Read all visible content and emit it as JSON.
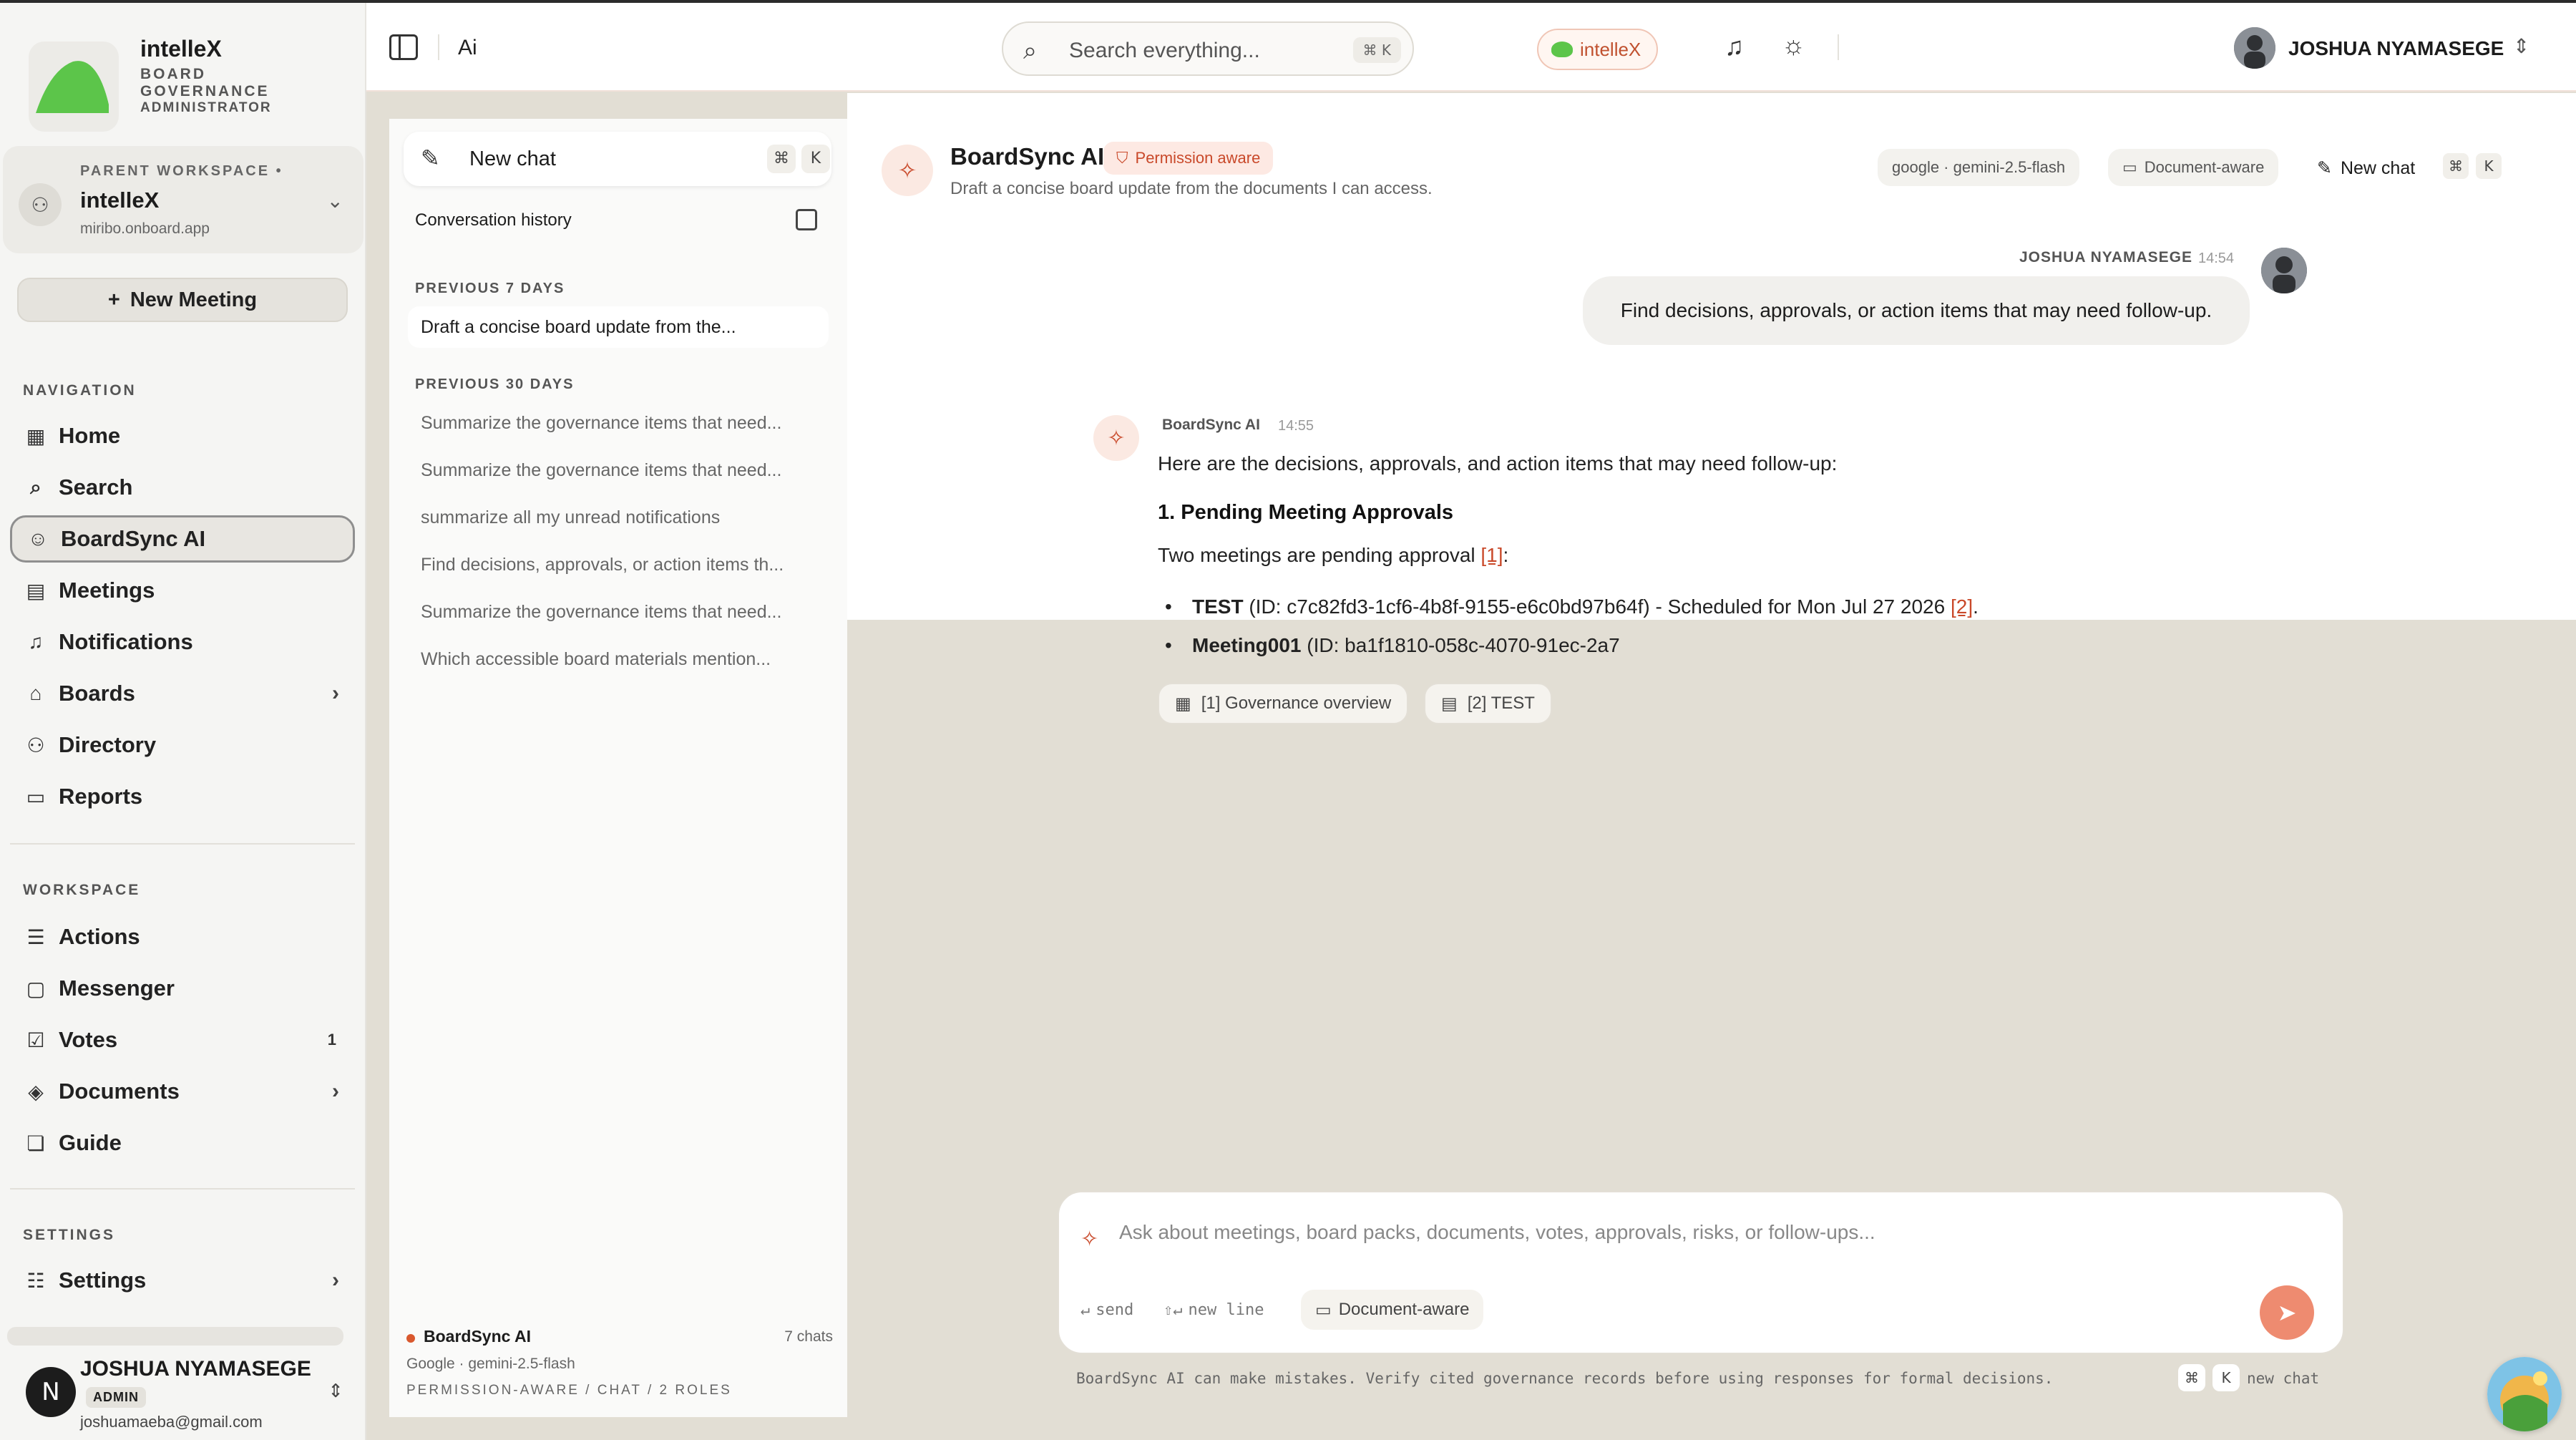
{
  "brand": {
    "name": "intelleX",
    "subtitle": "BOARD GOVERNANCE",
    "role": "ADMINISTRATOR"
  },
  "workspace": {
    "label": "PARENT WORKSPACE",
    "name": "intelleX",
    "url": "miribo.onboard.app"
  },
  "new_meeting_label": "New Meeting",
  "sidebar": {
    "navigation_label": "NAVIGATION",
    "navigation": [
      {
        "label": "Home",
        "icon": "grid-icon"
      },
      {
        "label": "Search",
        "icon": "telescope-icon"
      },
      {
        "label": "BoardSync AI",
        "icon": "bot-icon",
        "active": true
      },
      {
        "label": "Meetings",
        "icon": "calendar-icon"
      },
      {
        "label": "Notifications",
        "icon": "bell-icon"
      },
      {
        "label": "Boards",
        "icon": "building-icon",
        "chevron": true
      },
      {
        "label": "Directory",
        "icon": "users-icon"
      },
      {
        "label": "Reports",
        "icon": "file-icon"
      }
    ],
    "workspace_label": "WORKSPACE",
    "workspace": [
      {
        "label": "Actions",
        "icon": "list-check-icon"
      },
      {
        "label": "Messenger",
        "icon": "chat-icon"
      },
      {
        "label": "Votes",
        "icon": "vote-icon",
        "count": "1"
      },
      {
        "label": "Documents",
        "icon": "layers-icon",
        "chevron": true
      },
      {
        "label": "Guide",
        "icon": "book-icon"
      }
    ],
    "settings_label": "SETTINGS",
    "settings": [
      {
        "label": "Settings",
        "icon": "sliders-icon",
        "chevron": true
      }
    ]
  },
  "user_card": {
    "initial": "N",
    "name": "JOSHUA NYAMASEGE",
    "role": "ADMIN",
    "email": "joshuamaeba@gmail.com"
  },
  "topbar": {
    "breadcrumb": "Ai",
    "search_placeholder": "Search everything...",
    "search_shortcut": "⌘ K",
    "org_chip": "intelleX",
    "user_name": "JOSHUA NYAMASEGE"
  },
  "conversations": {
    "new_chat": "New chat",
    "kbd1": "⌘",
    "kbd2": "K",
    "history_label": "Conversation history",
    "sections": [
      {
        "label": "PREVIOUS 7 DAYS",
        "items": [
          "Draft a concise board update from the..."
        ]
      },
      {
        "label": "PREVIOUS 30 DAYS",
        "items": [
          "Summarize the governance items that need...",
          "Summarize the governance items that need...",
          "summarize all my unread notifications",
          "Find decisions, approvals, or action items th...",
          "Summarize the governance items that need...",
          "Which accessible board materials mention..."
        ]
      }
    ],
    "footer": {
      "name": "BoardSync AI",
      "count": "7 chats",
      "model": "Google · gemini-2.5-flash",
      "meta": "PERMISSION-AWARE / CHAT / 2 ROLES"
    }
  },
  "chat": {
    "title": "BoardSync AI",
    "badge": "Permission aware",
    "subtitle": "Draft a concise board update from the documents I can access.",
    "model_chip": "google · gemini-2.5-flash",
    "doc_chip": "Document-aware",
    "new_chat": "New chat",
    "kbd1": "⌘",
    "kbd2": "K",
    "user_message": {
      "author": "JOSHUA NYAMASEGE",
      "time": "14:54",
      "text": "Find decisions, approvals, or action items that may need follow-up."
    },
    "ai_message": {
      "author": "BoardSync AI",
      "time": "14:55",
      "intro": "Here are the decisions, approvals, and action items that may need follow-up:",
      "heading": "1. Pending Meeting Approvals",
      "para_prefix": "Two meetings are pending approval ",
      "para_cite": "[1]",
      "para_suffix": ":",
      "bullet1_bold": "TEST",
      "bullet1_text": " (ID: c7c82fd3-1cf6-4b8f-9155-e6c0bd97b64f) - Scheduled for Mon Jul 27 2026 ",
      "bullet1_cite": "[2]",
      "bullet1_end": ".",
      "bullet2_bold": "Meeting001",
      "bullet2_text": " (ID: ba1f1810-058c-4070-91ec-2a7",
      "sources": [
        "[1] Governance overview",
        "[2] TEST"
      ]
    }
  },
  "composer": {
    "placeholder": "Ask about meetings, board packs, documents, votes, approvals, risks, or follow-ups...",
    "hint_send": "send",
    "hint_newline": "new line",
    "doc_chip": "Document-aware"
  },
  "footer": {
    "disclaimer": "BoardSync AI can make mistakes. Verify cited governance records before using responses for formal decisions.",
    "kbd1": "⌘",
    "kbd2": "K",
    "new_chat": "new chat"
  },
  "colors": {
    "accent": "#c9492a",
    "brand_green": "#5cc54a",
    "beige_bg": "#e2ded4"
  }
}
